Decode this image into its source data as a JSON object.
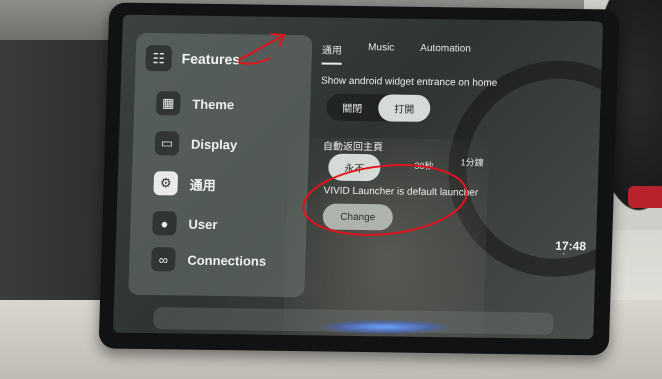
{
  "sidebar": {
    "title": "Features",
    "items": [
      {
        "label": "Theme",
        "icon": "grid-icon"
      },
      {
        "label": "Display",
        "icon": "display-icon"
      },
      {
        "label": "通用",
        "icon": "gear-icon"
      },
      {
        "label": "User",
        "icon": "user-icon"
      },
      {
        "label": "Connections",
        "icon": "link-icon"
      }
    ]
  },
  "tabs": [
    "通用",
    "Music",
    "Automation"
  ],
  "settings": {
    "widget_label": "Show android widget entrance on home",
    "widget_options": [
      "關閉",
      "打開"
    ],
    "widget_selected": "打開",
    "return_label": "自動返回主頁",
    "return_options": [
      "永不",
      "30秒",
      "1分鐘"
    ],
    "return_selected": "永不",
    "launcher_label": "VIVID Launcher is default launcher",
    "change_button": "Change"
  },
  "status": {
    "time": "17:48"
  },
  "colors": {
    "annotation_red": "#e0141c",
    "screen_bg": "#2f3432",
    "selected_pill": "#d7dbd7"
  }
}
